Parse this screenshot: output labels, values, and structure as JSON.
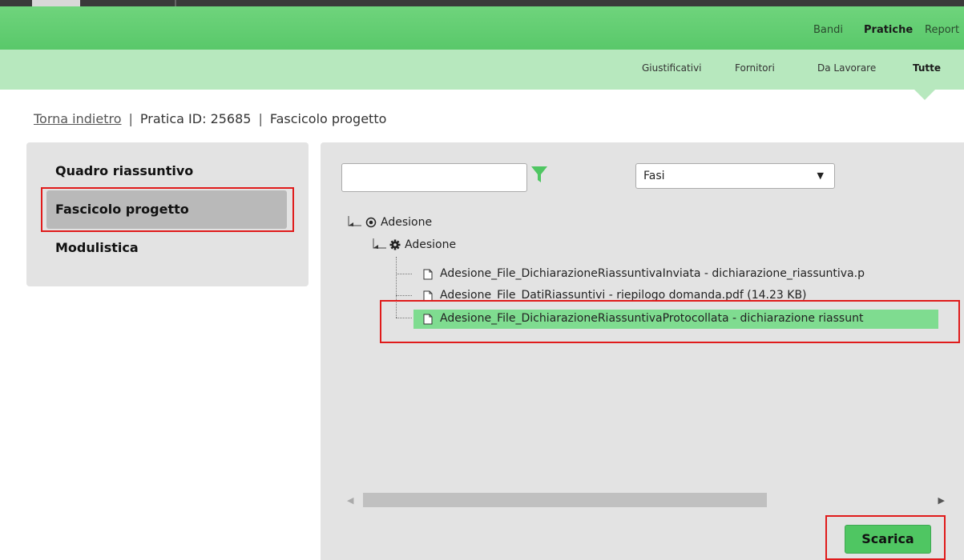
{
  "top_nav": {
    "items": [
      "Bandi",
      "Pratiche",
      "Report"
    ],
    "active": "Pratiche"
  },
  "sub_nav": {
    "items": [
      "Giustificativi",
      "Fornitori",
      "Da Lavorare",
      "Tutte"
    ],
    "active": "Tutte"
  },
  "breadcrumb": {
    "back": "Torna indietro",
    "separator": "|",
    "pratica_id": "Pratica ID: 25685",
    "section": "Fascicolo progetto"
  },
  "sidebar": {
    "items": [
      "Quadro riassuntivo",
      "Fascicolo progetto",
      "Modulistica"
    ],
    "active": "Fascicolo progetto"
  },
  "filters": {
    "search_value": "",
    "select_value": "Fasi",
    "select_arrow": "▼"
  },
  "tree": {
    "root": "Adesione",
    "phase": "Adesione",
    "files": [
      "Adesione_File_DichiarazioneRiassuntivaInviata - dichiarazione_riassuntiva.p",
      "Adesione_File_DatiRiassuntivi - riepilogo domanda.pdf (14.23 KB)",
      "Adesione_File_DichiarazioneRiassuntivaProtocollata - dichiarazione riassunt"
    ],
    "selected_file": "Adesione_File_DichiarazioneRiassuntivaProtocollata - dichiarazione riassunt"
  },
  "scrollbar": {
    "left_arrow": "◀",
    "right_arrow": "▶"
  },
  "actions": {
    "download_label": "Scarica"
  },
  "colors": {
    "nav_green": "#5fcb6f",
    "subnav_green": "#b7e8be",
    "selected_green": "#7fdc90",
    "button_green": "#4fc662",
    "highlight_red": "#e01b1b",
    "panel_gray": "#e3e3e3"
  }
}
